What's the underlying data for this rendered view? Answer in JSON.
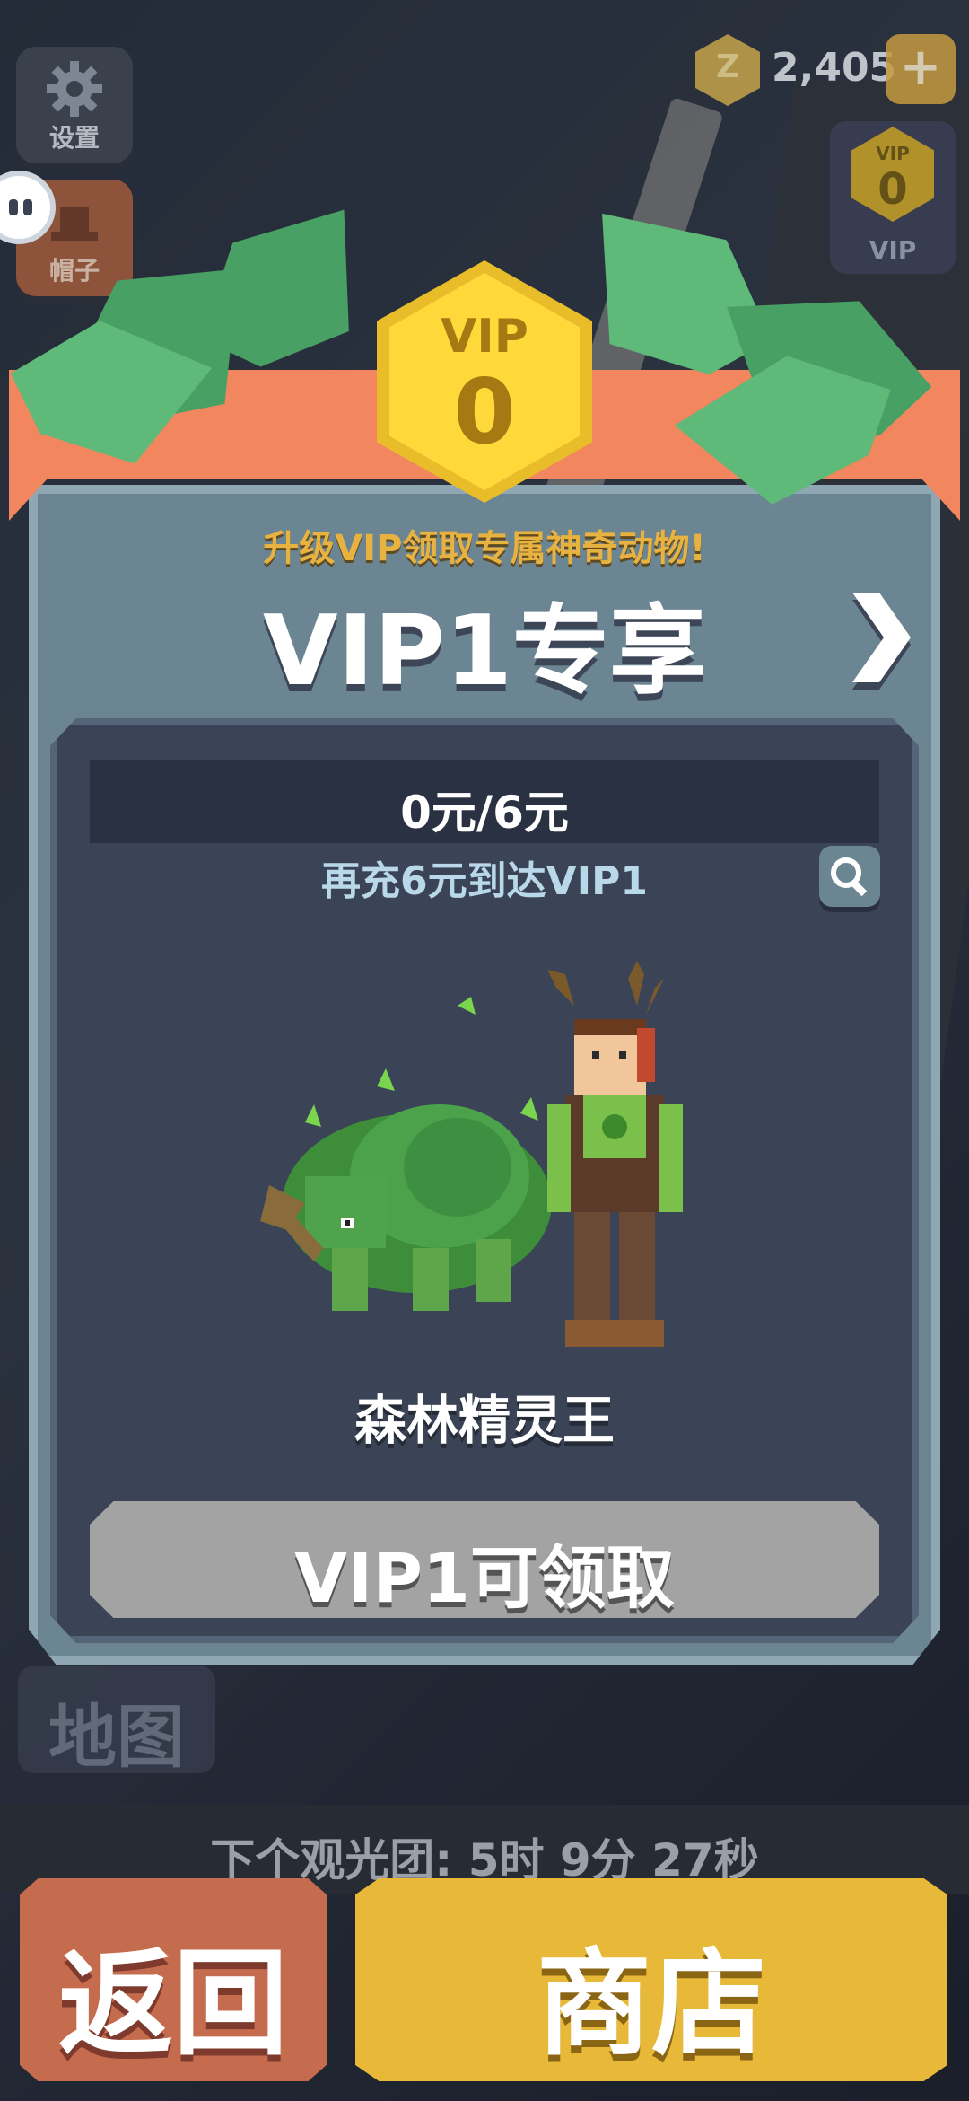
{
  "hud": {
    "settings_label": "设置",
    "hat_label": "帽子",
    "map_label": "地图",
    "coin_value": "2,405",
    "coin_glyph": "Z",
    "plus_glyph": "+",
    "vip_mini_top": "VIP",
    "vip_mini_level": "0",
    "vip_mini_label": "VIP"
  },
  "modal": {
    "vip_badge_top": "VIP",
    "vip_badge_level": "0",
    "subtitle": "升级VIP领取专属神奇动物!",
    "title": "VIP1专享",
    "progress": "0元/6元",
    "hint": "再充6元到达VIP1",
    "pet_name": "森林精灵王",
    "claim_button": "VIP1可领取"
  },
  "footer": {
    "timer": "下个观光团: 5时 9分 27秒",
    "back_button": "返回",
    "shop_button": "商店"
  },
  "colors": {
    "ribbon": "#f1865f",
    "vip_gold": "#ffd93a",
    "panel": "#6b8593",
    "back_button": "#c66c4e",
    "shop_button": "#e8b938"
  },
  "icons": [
    "gear-icon",
    "hat-icon",
    "coin-icon",
    "plus-icon",
    "chevron-right-icon",
    "search-icon"
  ]
}
